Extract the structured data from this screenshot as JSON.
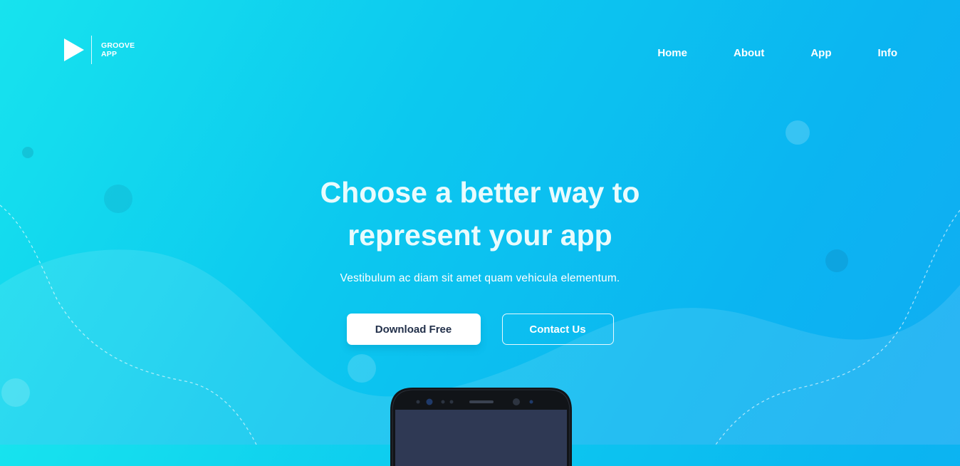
{
  "brand": {
    "line1": "GROOVE",
    "line2": "APP",
    "icon": "play-triangle-icon"
  },
  "nav": {
    "items": [
      "Home",
      "About",
      "App",
      "Info"
    ]
  },
  "hero": {
    "title": "Choose a better way to represent your app",
    "subtitle": "Vestibulum ac diam sit amet quam vehicula elementum."
  },
  "buttons": {
    "primary": "Download Free",
    "secondary": "Contact Us"
  },
  "colors": {
    "gradient_start": "#17e3ee",
    "gradient_end": "#11acf3",
    "button_text": "#22304a",
    "phone_body": "#111418",
    "phone_screen": "#2f3954"
  }
}
